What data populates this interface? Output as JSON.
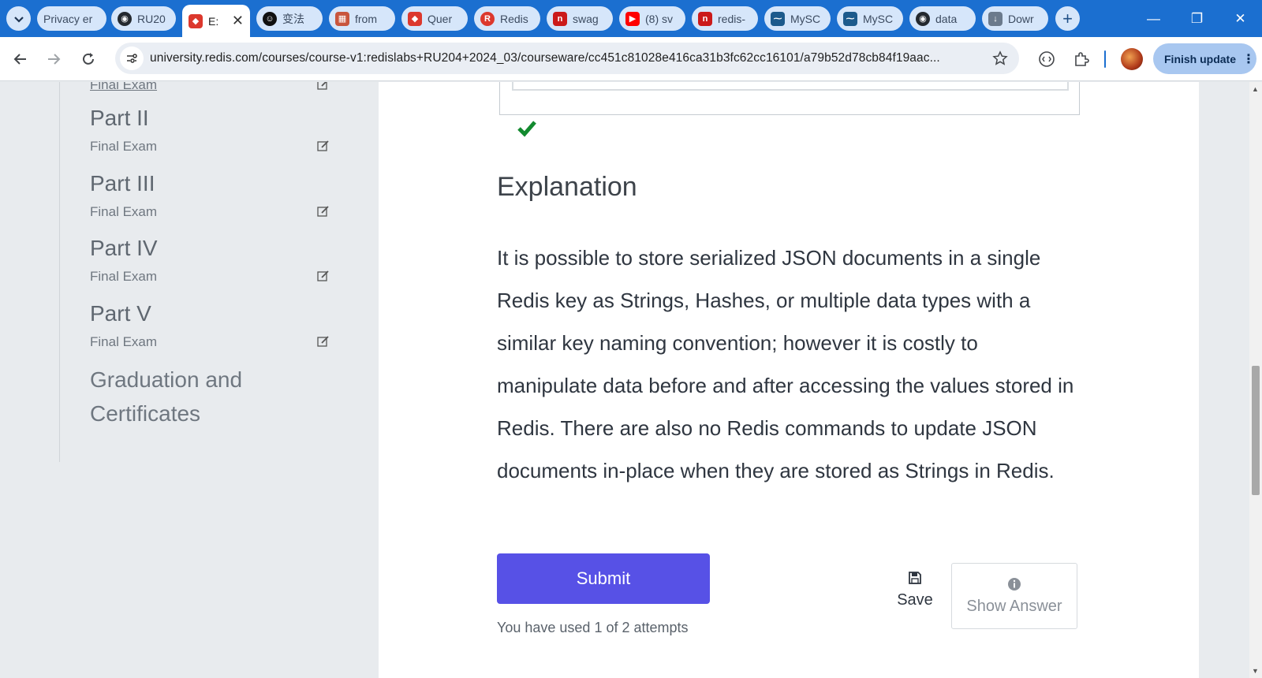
{
  "browser": {
    "tabs": [
      {
        "label": "Privacy er",
        "icon": "privacy-icon"
      },
      {
        "label": "RU20",
        "icon": "github-icon"
      },
      {
        "label": "E:",
        "icon": "redis-cube-icon",
        "active": true
      },
      {
        "label": "变法",
        "icon": "chat-bot-icon"
      },
      {
        "label": "from",
        "icon": "grid-logo-icon"
      },
      {
        "label": "Quer",
        "icon": "redis-cube-icon"
      },
      {
        "label": "Redis",
        "icon": "redis-logo-icon"
      },
      {
        "label": "swag",
        "icon": "n-logo-icon"
      },
      {
        "label": "(8) sv",
        "icon": "youtube-icon"
      },
      {
        "label": "redis-",
        "icon": "n-logo-icon"
      },
      {
        "label": "MySC",
        "icon": "mysql-icon"
      },
      {
        "label": "MySC",
        "icon": "mysql-icon"
      },
      {
        "label": "data",
        "icon": "github-icon"
      },
      {
        "label": "Dowr",
        "icon": "download-icon"
      }
    ],
    "url": "university.redis.com/courses/course-v1:redislabs+RU204+2024_03/courseware/cc451c81028e416ca31b3fc62cc16101/a79b52d78cb84f19aac...",
    "finish_update_label": "Finish update"
  },
  "sidebar": {
    "cut_item": "Final Exam",
    "parts": [
      {
        "title": "Part II",
        "subtitle": "Final Exam"
      },
      {
        "title": "Part III",
        "subtitle": "Final Exam"
      },
      {
        "title": "Part IV",
        "subtitle": "Final Exam"
      },
      {
        "title": "Part V",
        "subtitle": "Final Exam"
      }
    ],
    "graduation": "Graduation and Certificates"
  },
  "main": {
    "explanation_title": "Explanation",
    "explanation_text": "It is possible to store serialized JSON documents in a single Redis key as Strings, Hashes, or multiple data types with a similar key naming convention; however it is costly to manipulate data before and after accessing the values stored in Redis. There are also no Redis commands to update JSON documents in-place when they are stored as Strings in Redis.",
    "submit_label": "Submit",
    "attempts_text": "You have used 1 of 2 attempts",
    "save_label": "Save",
    "show_answer_label": "Show Answer"
  },
  "colors": {
    "tab_strip": "#1b6fd0",
    "submit_button": "#5751e6",
    "check_mark": "#138a2f"
  }
}
